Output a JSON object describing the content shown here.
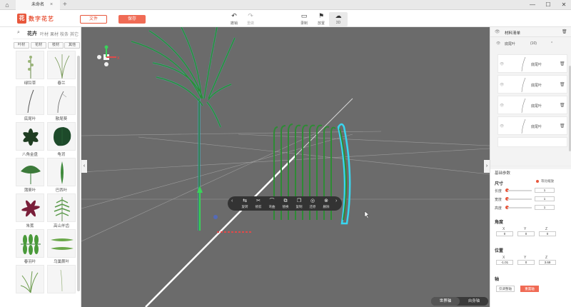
{
  "titlebar": {
    "tab_title": "未命名",
    "icons": [
      "home-icon",
      "close-icon",
      "plus-icon",
      "minimize-icon",
      "maximize-icon",
      "window-close-icon"
    ]
  },
  "toolbar": {
    "logo_mark": "花",
    "logo_text": "数字花艺",
    "file_label": "文件",
    "save_label": "保存",
    "tools": [
      {
        "label": "撤销",
        "icon": "undo-icon",
        "disabled": false
      },
      {
        "label": "重做",
        "icon": "redo-icon",
        "disabled": true
      },
      {
        "label": "录制",
        "icon": "record-icon",
        "disabled": false
      },
      {
        "label": "放置",
        "icon": "place-icon",
        "disabled": false
      },
      {
        "label": "3D",
        "icon": "3d-view-icon",
        "disabled": false
      }
    ]
  },
  "left_panel": {
    "categories": [
      "花卉",
      "叶材",
      "果材",
      "枝条",
      "其它"
    ],
    "active_category": "花卉",
    "subcategories": [
      "叶材",
      "花材",
      "枝材",
      "其他"
    ],
    "items": [
      {
        "name": "绿铃草"
      },
      {
        "name": "春兰"
      },
      {
        "name": "底尾叶"
      },
      {
        "name": "散尾葵"
      },
      {
        "name": "八角金盘"
      },
      {
        "name": "龟背"
      },
      {
        "name": "蒲葵叶"
      },
      {
        "name": "巴西叶"
      },
      {
        "name": "朱蕉"
      },
      {
        "name": "高山羊齿"
      },
      {
        "name": "春羽叶"
      },
      {
        "name": "乌巢蕨叶"
      },
      {
        "name": ""
      },
      {
        "name": ""
      }
    ]
  },
  "viewport": {
    "float_toolbar": [
      {
        "label": "旋转",
        "icon": "rotate-icon"
      },
      {
        "label": "修剪",
        "icon": "scissors-icon"
      },
      {
        "label": "弯曲",
        "icon": "bend-icon"
      },
      {
        "label": "替换",
        "icon": "replace-icon"
      },
      {
        "label": "复制",
        "icon": "copy-icon"
      },
      {
        "label": "还原",
        "icon": "restore-icon"
      },
      {
        "label": "删除",
        "icon": "delete-icon"
      }
    ],
    "axis_toggle": {
      "world": "世界轴",
      "self": "自身轴"
    },
    "colors": {
      "background": "#6b6b6b",
      "grid": "#bdbdbd",
      "leaf": "#2e8b35",
      "highlight": "#38d6f0"
    }
  },
  "right_panel": {
    "material_header": "材料清单",
    "group_name": "底尾叶",
    "group_count": "(10)",
    "material_rows": [
      "底尾叶",
      "底尾叶",
      "底尾叶",
      "底尾叶"
    ],
    "basic_params": "基础参数",
    "size": {
      "title": "尺寸",
      "ratio_label": "等比缩放",
      "rows": [
        {
          "label": "长度",
          "value": "1"
        },
        {
          "label": "宽度",
          "value": "1"
        },
        {
          "label": "高度",
          "value": "1"
        }
      ]
    },
    "angle": {
      "title": "角度",
      "x": "0",
      "y": "0",
      "z": "0"
    },
    "position": {
      "title": "位置",
      "x": "-1.01",
      "y": "0",
      "z": "3.68"
    },
    "axis": {
      "title": "轴",
      "btn1": "仅调整轴",
      "btn2": "重置轴"
    },
    "accent": "#e8573c"
  }
}
